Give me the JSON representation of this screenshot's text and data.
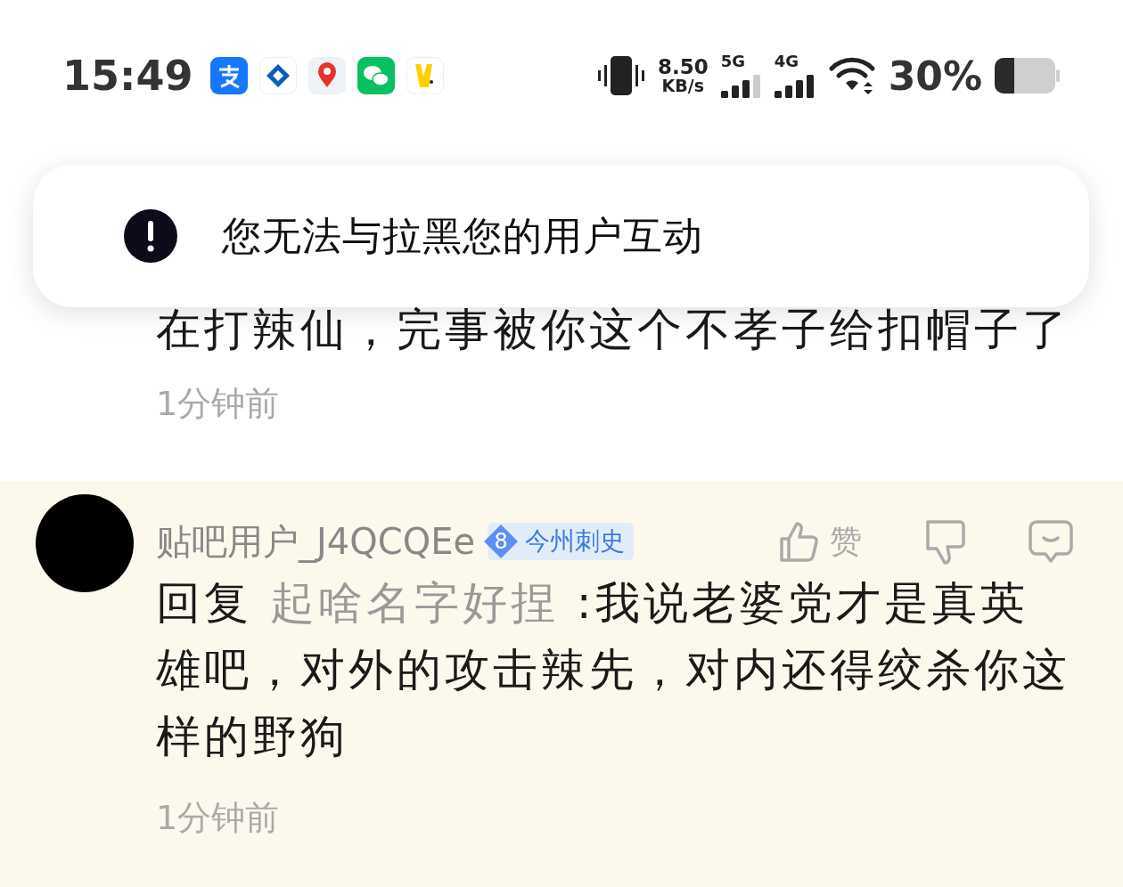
{
  "status_bar": {
    "time": "15:49",
    "network_speed": "8.50",
    "network_speed_unit": "KB/s",
    "signal_1_label": "5G",
    "signal_2_label": "4G",
    "battery": "30%"
  },
  "toast": {
    "message": "您无法与拉黑您的用户互动"
  },
  "comments": [
    {
      "highlighted": false,
      "text": "在打辣仙，完事被你这个不孝子给扣帽子了",
      "time": "1分钟前"
    },
    {
      "highlighted": true,
      "username": "贴吧用户_J4QCQEe",
      "level": "8",
      "title": "今州刺史",
      "like_label": "赞",
      "reply_prefix": "回复",
      "reply_to": "起啥名字好捏",
      "text": ":我说老婆党才是真英雄吧，对外的攻击辣先，对内还得绞杀你这样的野狗",
      "time": "1分钟前"
    }
  ]
}
